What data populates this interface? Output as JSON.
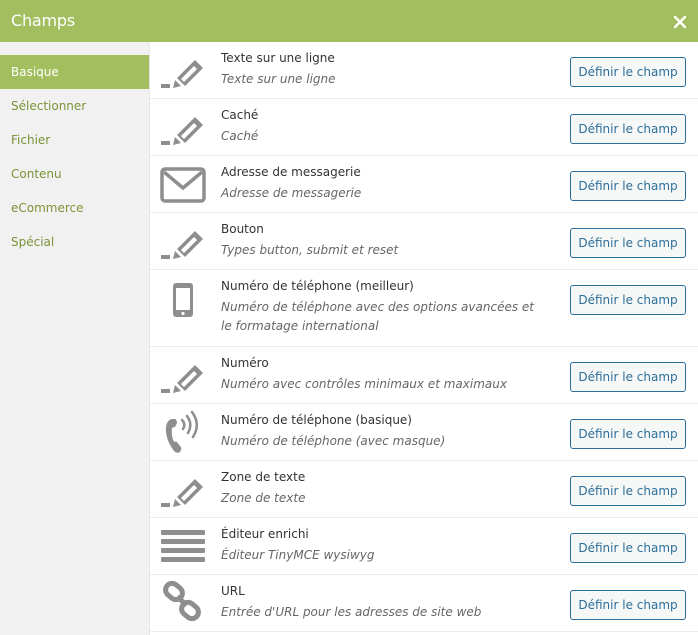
{
  "header": {
    "title": "Champs",
    "close_icon": "close-icon",
    "bg_color": "#a3be5f"
  },
  "sidebar": {
    "items": [
      {
        "label": "Basique",
        "active": true
      },
      {
        "label": "Sélectionner",
        "active": false
      },
      {
        "label": "Fichier",
        "active": false
      },
      {
        "label": "Contenu",
        "active": false
      },
      {
        "label": "eCommerce",
        "active": false
      },
      {
        "label": "Spécial",
        "active": false
      }
    ]
  },
  "fields": [
    {
      "name": "Texte sur une ligne",
      "description": "Texte sur une ligne",
      "icon": "pencil-icon",
      "button": "Définir le champ"
    },
    {
      "name": "Caché",
      "description": "Caché",
      "icon": "pencil-icon",
      "button": "Définir le champ"
    },
    {
      "name": "Adresse de messagerie",
      "description": "Adresse de messagerie",
      "icon": "envelope-icon",
      "button": "Définir le champ"
    },
    {
      "name": "Bouton",
      "description": "Types button, submit et reset",
      "icon": "pencil-icon",
      "button": "Définir le champ"
    },
    {
      "name": "Numéro de téléphone (meilleur)",
      "description": "Numéro de téléphone avec des options avancées et le formatage international",
      "icon": "smartphone-icon",
      "button": "Définir le champ"
    },
    {
      "name": "Numéro",
      "description": "Numéro avec contrôles minimaux et maximaux",
      "icon": "pencil-icon",
      "button": "Définir le champ"
    },
    {
      "name": "Numéro de téléphone (basique)",
      "description": "Numéro de téléphone (avec masque)",
      "icon": "phone-ringing-icon",
      "button": "Définir le champ"
    },
    {
      "name": "Zone de texte",
      "description": "Zone de texte",
      "icon": "pencil-icon",
      "button": "Définir le champ"
    },
    {
      "name": "Éditeur enrichi",
      "description": "Éditeur TinyMCE wysiwyg",
      "icon": "text-lines-icon",
      "button": "Définir le champ"
    },
    {
      "name": "URL",
      "description": "Entrée d'URL pour les adresses de site web",
      "icon": "link-icon",
      "button": "Définir le champ"
    }
  ]
}
